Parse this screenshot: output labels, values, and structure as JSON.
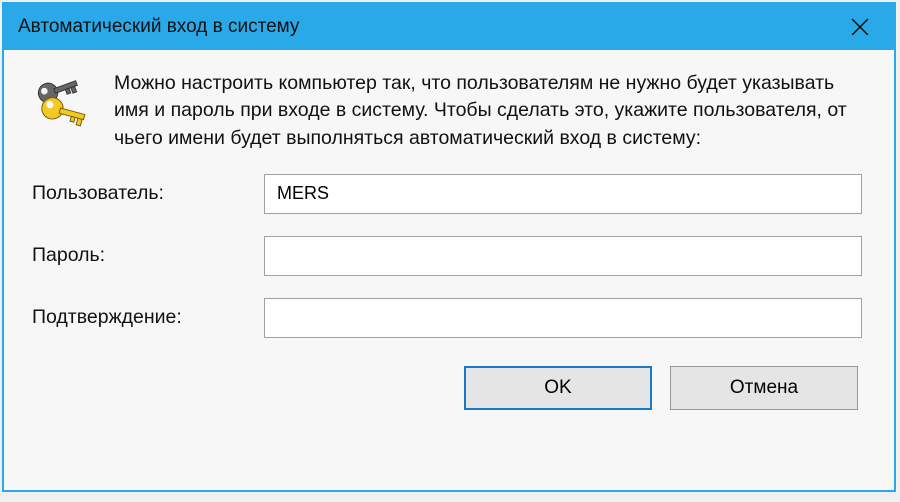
{
  "titlebar": {
    "title": "Автоматический вход в систему"
  },
  "description": "Можно настроить компьютер так, что пользователям не нужно будет указывать имя и пароль при входе в систему. Чтобы сделать это, укажите пользователя, от чьего имени будет выполняться автоматический вход в систему:",
  "form": {
    "user_label": "Пользователь:",
    "user_value": "MERS",
    "password_label": "Пароль:",
    "password_value": "",
    "confirm_label": "Подтверждение:",
    "confirm_value": ""
  },
  "buttons": {
    "ok": "OK",
    "cancel": "Отмена"
  }
}
